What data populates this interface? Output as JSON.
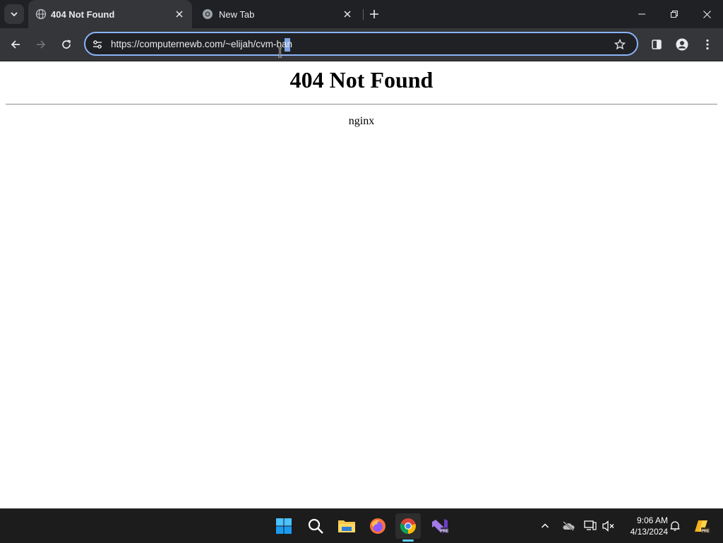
{
  "browser": {
    "tabs": [
      {
        "title": "404 Not Found",
        "active": true,
        "favicon": "globe-icon"
      },
      {
        "title": "New Tab",
        "active": false,
        "favicon": "chrome-icon"
      }
    ],
    "address_bar": {
      "url": "https://computernewb.com/~elijah/cvm-ban"
    },
    "colors": {
      "titlebar": "#202124",
      "toolbar": "#35363a",
      "omnibox_border": "#8ab4f8"
    }
  },
  "page": {
    "heading": "404 Not Found",
    "server": "nginx"
  },
  "taskbar": {
    "apps": [
      "windows-start-icon",
      "search-icon",
      "file-explorer-icon",
      "firefox-icon",
      "chrome-icon",
      "visual-studio-preview-icon"
    ],
    "clock": {
      "time": "9:06 AM",
      "date": "4/13/2024"
    },
    "tray": [
      "chevron-up-icon",
      "onedrive-icon",
      "network-icon",
      "volume-muted-icon",
      "notification-bell-icon",
      "copilot-icon"
    ]
  }
}
